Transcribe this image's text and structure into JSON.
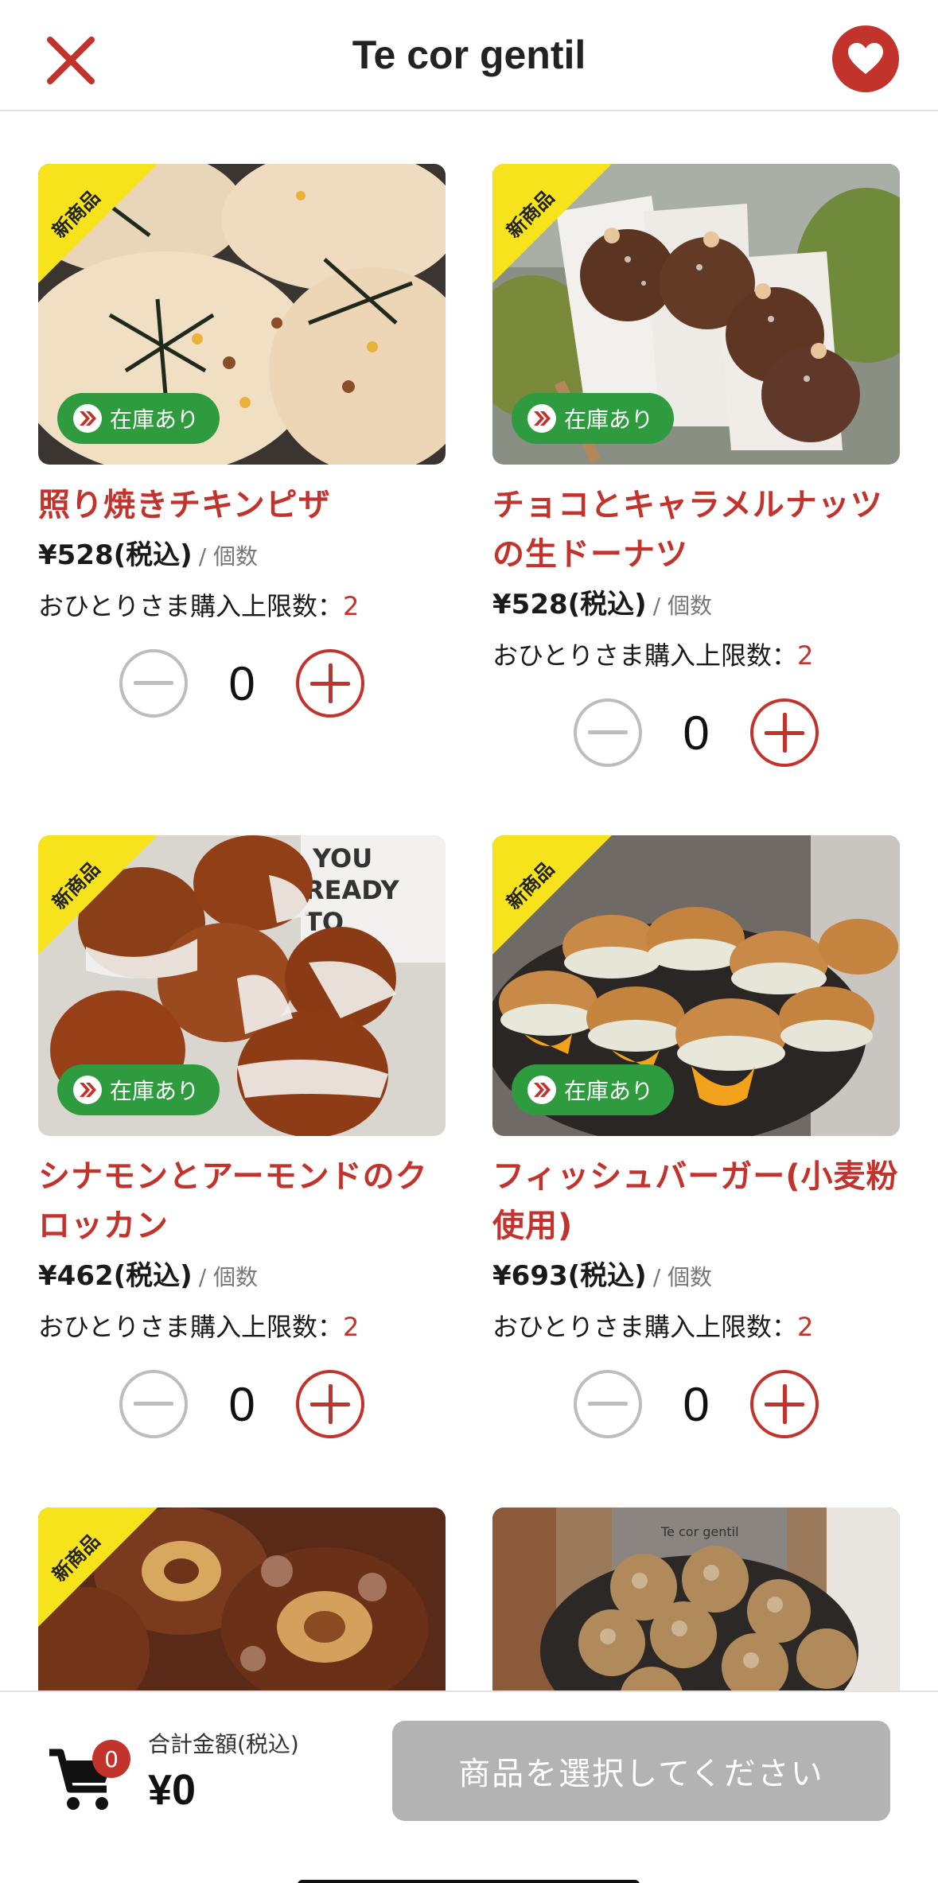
{
  "header": {
    "title": "Te cor gentil",
    "close_icon": "close-icon",
    "favorite_icon": "heart-icon"
  },
  "badges": {
    "new": "新商品",
    "stock": "在庫あり"
  },
  "products": [
    {
      "name": "照り焼きチキンピザ",
      "price": "¥528(税込)",
      "unit": "/ 個数",
      "limit_label": "おひとりさま購入上限数：",
      "limit": "2",
      "qty": "0",
      "in_stock": true,
      "is_new": true
    },
    {
      "name": "チョコとキャラメルナッツの生ドーナツ",
      "price": "¥528(税込)",
      "unit": "/ 個数",
      "limit_label": "おひとりさま購入上限数：",
      "limit": "2",
      "qty": "0",
      "in_stock": true,
      "is_new": true
    },
    {
      "name": "シナモンとアーモンドのクロッカン",
      "price": "¥462(税込)",
      "unit": "/ 個数",
      "limit_label": "おひとりさま購入上限数：",
      "limit": "2",
      "qty": "0",
      "in_stock": true,
      "is_new": true
    },
    {
      "name": "フィッシュバーガー(小麦粉使用)",
      "price": "¥693(税込)",
      "unit": "/ 個数",
      "limit_label": "おひとりさま購入上限数：",
      "limit": "2",
      "qty": "0",
      "in_stock": true,
      "is_new": true
    },
    {
      "is_new": true
    },
    {
      "is_new": false
    }
  ],
  "footer": {
    "cart_count": "0",
    "total_label": "合計金額(税込)",
    "total_value": "¥0",
    "checkout_label": "商品を選択してください"
  },
  "colors": {
    "accent": "#c2332c",
    "stock_green": "#2e9c3e",
    "ribbon_yellow": "#f6e31c",
    "disabled_gray": "#b3b3b3"
  }
}
